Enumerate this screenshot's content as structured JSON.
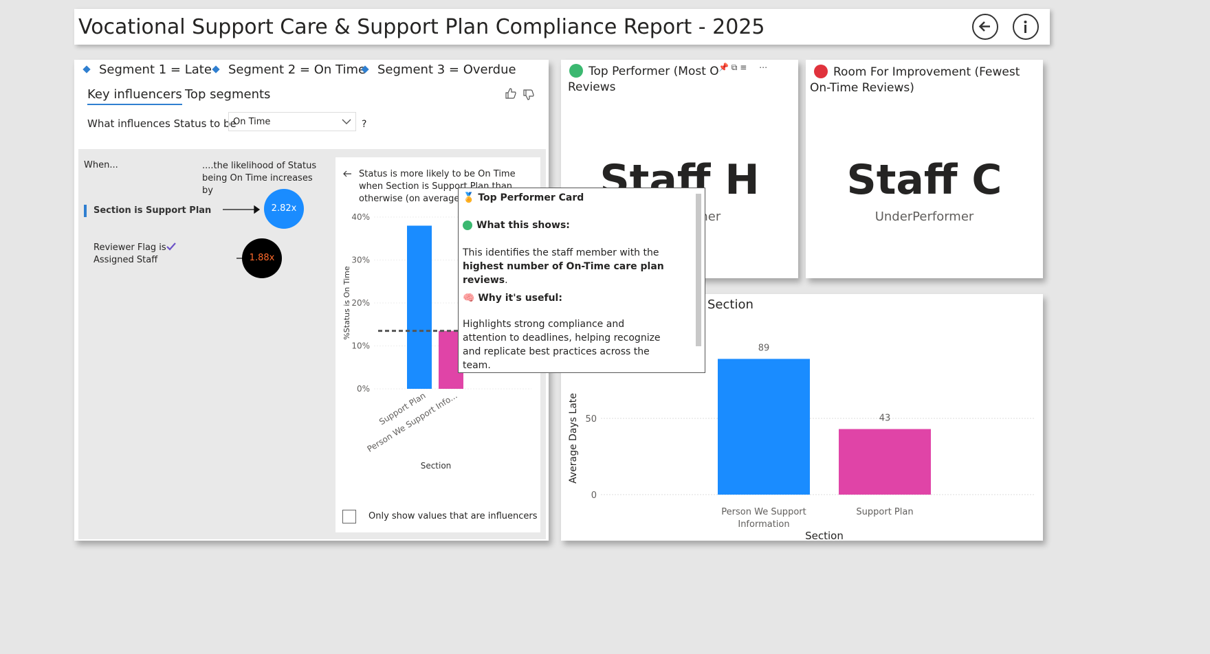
{
  "header": {
    "title": "Vocational Support Care & Support Plan Compliance Report - 2025",
    "back_icon": "arrow-left-circle-icon",
    "info_icon": "info-circle-icon"
  },
  "key_influencers": {
    "legend": [
      "Segment 1 = Late",
      "Segment 2 = On Time",
      "Segment 3 = Overdue"
    ],
    "tabs": [
      "Key influencers",
      "Top segments"
    ],
    "question_label": "What influences Status to be",
    "dropdown_value": "On Time",
    "question_mark": "?",
    "col_when": "When...",
    "col_likelihood": "....the likelihood of Status being On Time increases by",
    "influencers": [
      {
        "label": "Section is Support Plan",
        "value": "2.82x",
        "color": "#1a8cff"
      },
      {
        "label": "Reviewer Flag is Assigned Staff",
        "value": "1.88x",
        "color": "#000000"
      }
    ],
    "detail_title": "Status is more likely to be On Time when Section is Support Plan than otherwise (on average).",
    "checkbox_label": "Only show values that are influencers"
  },
  "top_performer": {
    "title": "Top Performer (Most On-Time Reviews",
    "title_line2": "Reviews",
    "name": "Staff H",
    "sub": "TopPerformer"
  },
  "room_improvement": {
    "title": "Room For Improvement (Fewest",
    "title_line2": "On-Time Reviews)",
    "name": "Staff C",
    "sub": "UnderPerformer"
  },
  "avg_days_chart": {
    "title": "Average Days Late by Section"
  },
  "tooltip": {
    "title": "Top Performer Card",
    "what_heading": "What this shows:",
    "what_text_1": "This identifies the staff member with the ",
    "what_text_bold": "highest number of On-Time care plan reviews",
    "what_text_end": ".",
    "why_heading": "Why it's useful:",
    "why_text": "Highlights strong compliance and attention to deadlines, helping recognize and replicate best practices across the team."
  },
  "chart_data": [
    {
      "type": "bar",
      "title": "",
      "categories": [
        "Support Plan",
        "Person We Support Info..."
      ],
      "values": [
        38,
        13.5
      ],
      "colors": [
        "#1a8cff",
        "#e044a7"
      ],
      "xlabel": "Section",
      "ylabel": "%Status is On Time",
      "ylim": [
        0,
        40
      ],
      "yticks": [
        "0%",
        "10%",
        "20%",
        "30%",
        "40%"
      ],
      "reference_line": 13.5
    },
    {
      "type": "bar",
      "title": "Average Days Late by Section",
      "categories": [
        "Person We Support Information",
        "Support Plan"
      ],
      "values": [
        89,
        43
      ],
      "colors": [
        "#1a8cff",
        "#e044a7"
      ],
      "xlabel": "Section",
      "ylabel": "Average Days Late",
      "ylim": [
        0,
        100
      ],
      "yticks": [
        "0",
        "50"
      ]
    }
  ]
}
